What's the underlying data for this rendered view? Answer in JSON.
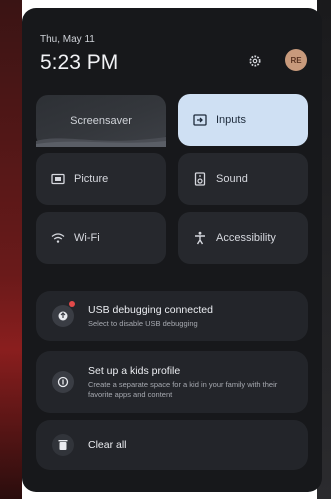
{
  "header": {
    "date": "Thu, May 11",
    "time": "5:23 PM",
    "avatar_initials": "RE"
  },
  "tiles": [
    {
      "label": "Screensaver",
      "icon": "screensaver-icon"
    },
    {
      "label": "Inputs",
      "icon": "inputs-icon",
      "active": true
    },
    {
      "label": "Picture",
      "icon": "picture-icon"
    },
    {
      "label": "Sound",
      "icon": "speaker-icon"
    },
    {
      "label": "Wi-Fi",
      "icon": "wifi-icon"
    },
    {
      "label": "Accessibility",
      "icon": "accessibility-icon"
    }
  ],
  "notifications": [
    {
      "title": "USB debugging connected",
      "subtitle": "Select to disable USB debugging",
      "icon": "usb-icon"
    },
    {
      "title": "Set up a kids profile",
      "subtitle": "Create a separate space for a kid in your family with their favorite apps and content",
      "icon": "kids-profile-icon"
    },
    {
      "title": "Clear all",
      "icon": "trash-icon"
    }
  ],
  "colors": {
    "panel": "#17181b",
    "tile": "#26282d",
    "active_tile": "#cfe0f3",
    "notification_dot": "#e24a4a"
  }
}
